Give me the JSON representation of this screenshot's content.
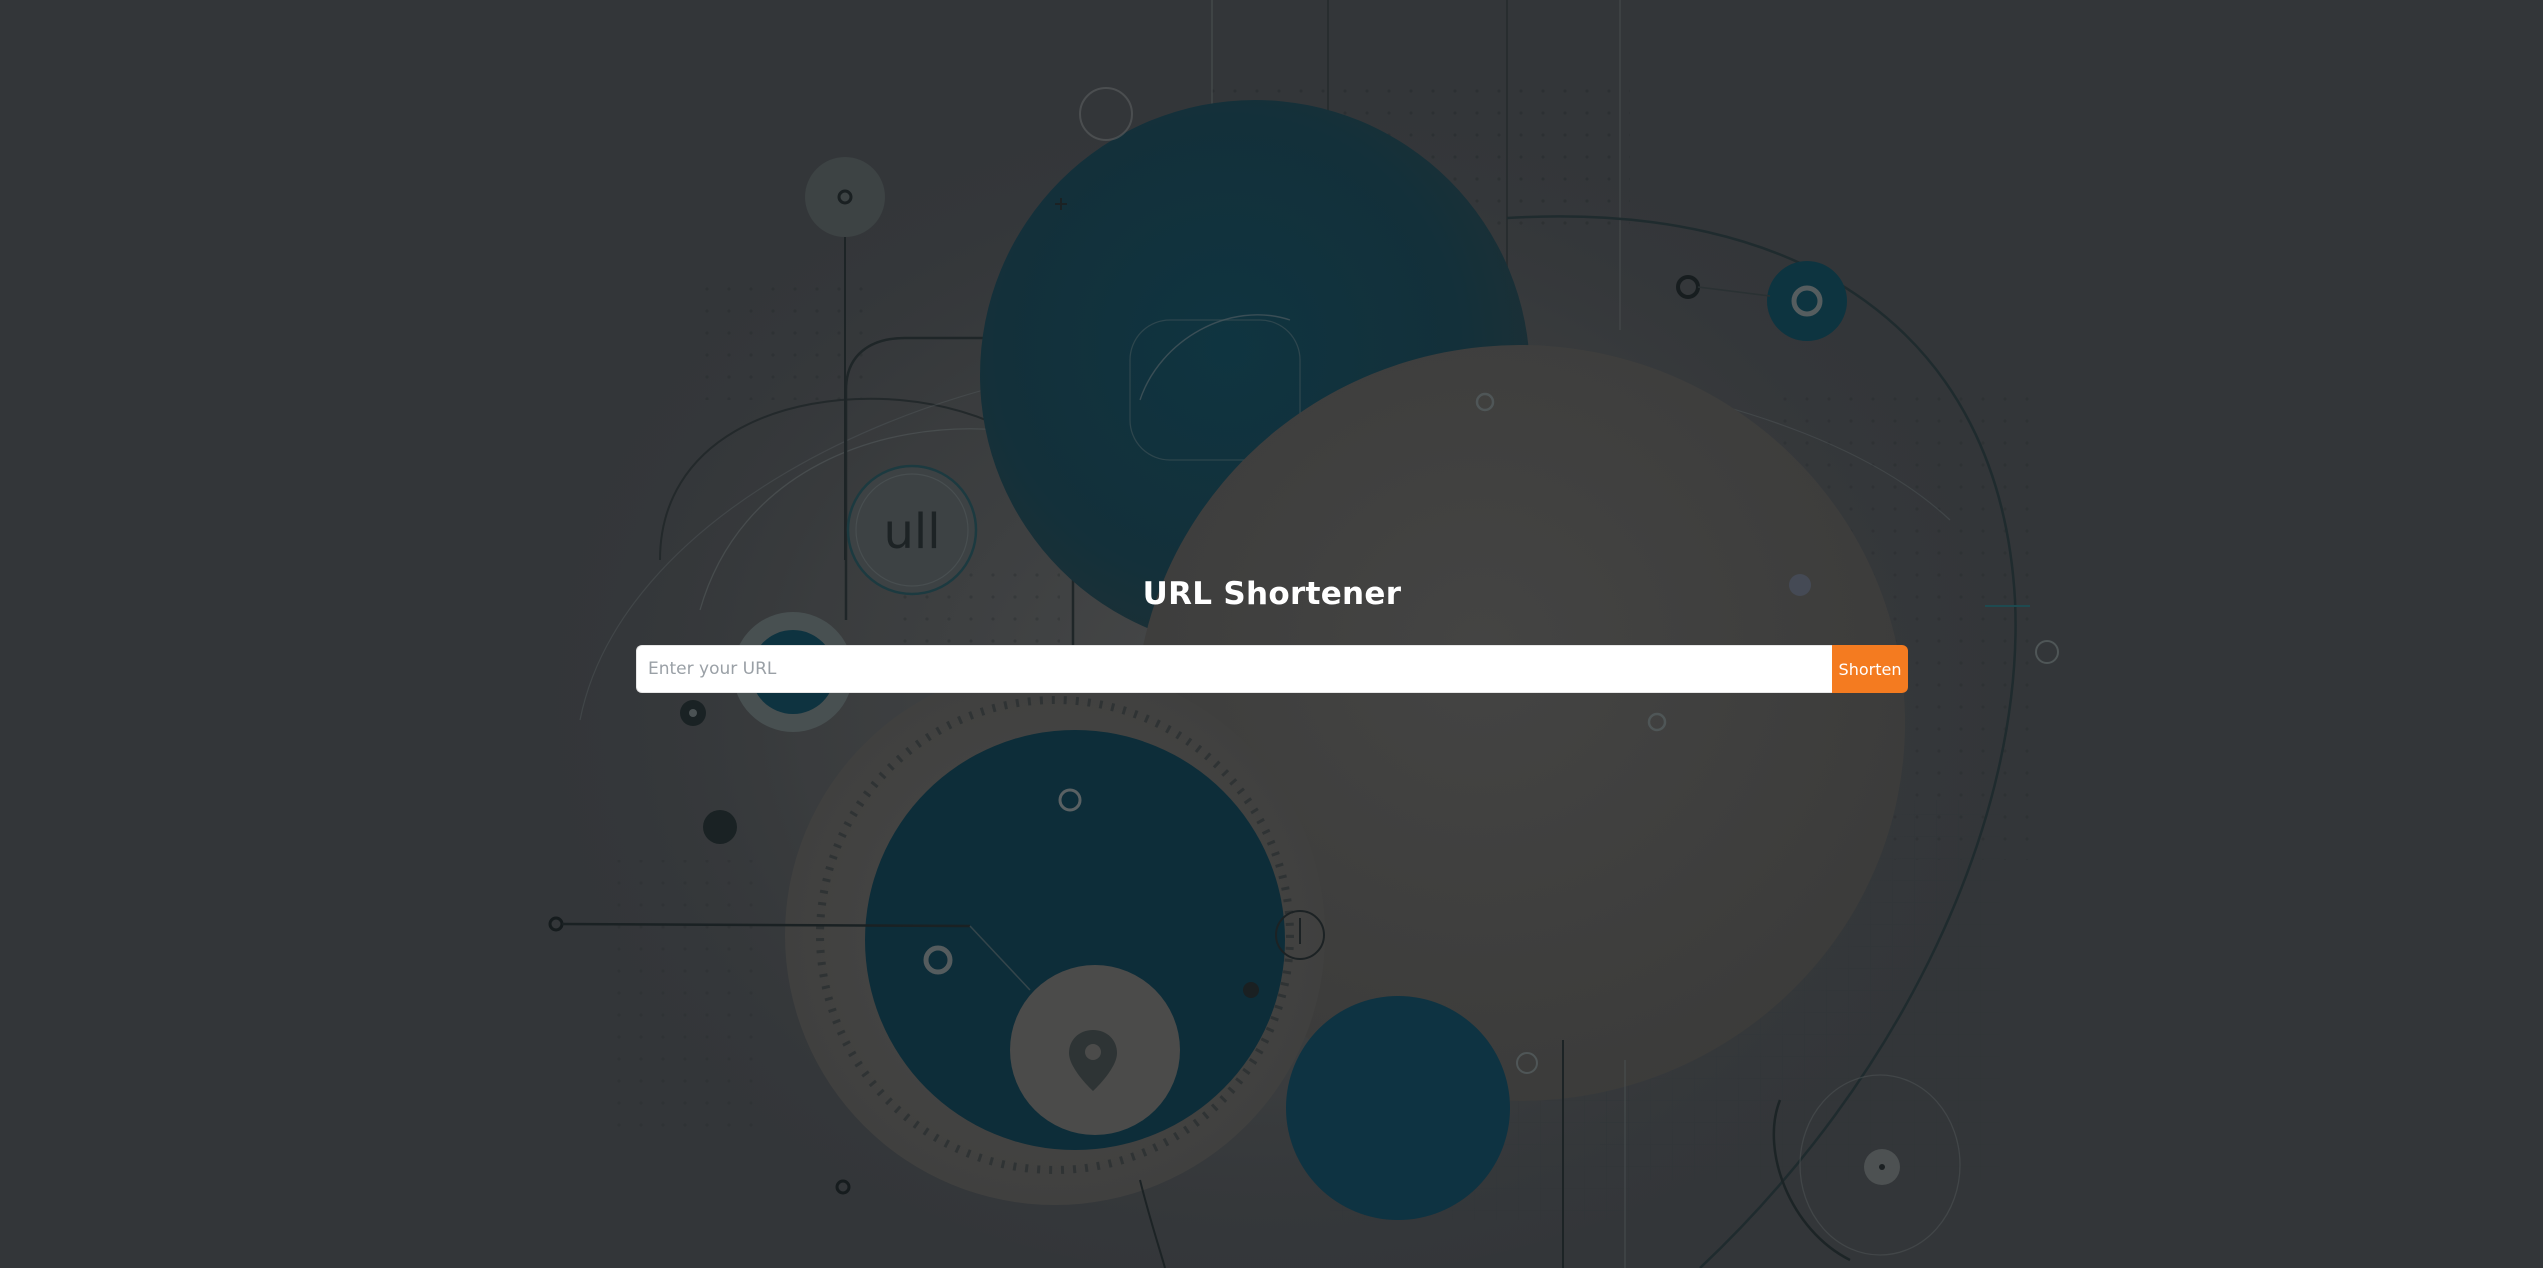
{
  "page": {
    "title": "URL Shortener"
  },
  "form": {
    "url_input": {
      "value": "",
      "placeholder": "Enter your URL"
    },
    "submit_label": "Shorten"
  },
  "background": {
    "art_text": "ull"
  },
  "colors": {
    "page_background": "#333639",
    "accent": "#f47b20",
    "title_text": "#ffffff",
    "input_background": "#ffffff",
    "placeholder_text": "#9aa0a6"
  },
  "icons": {
    "map_pin": "map-pin-icon"
  }
}
